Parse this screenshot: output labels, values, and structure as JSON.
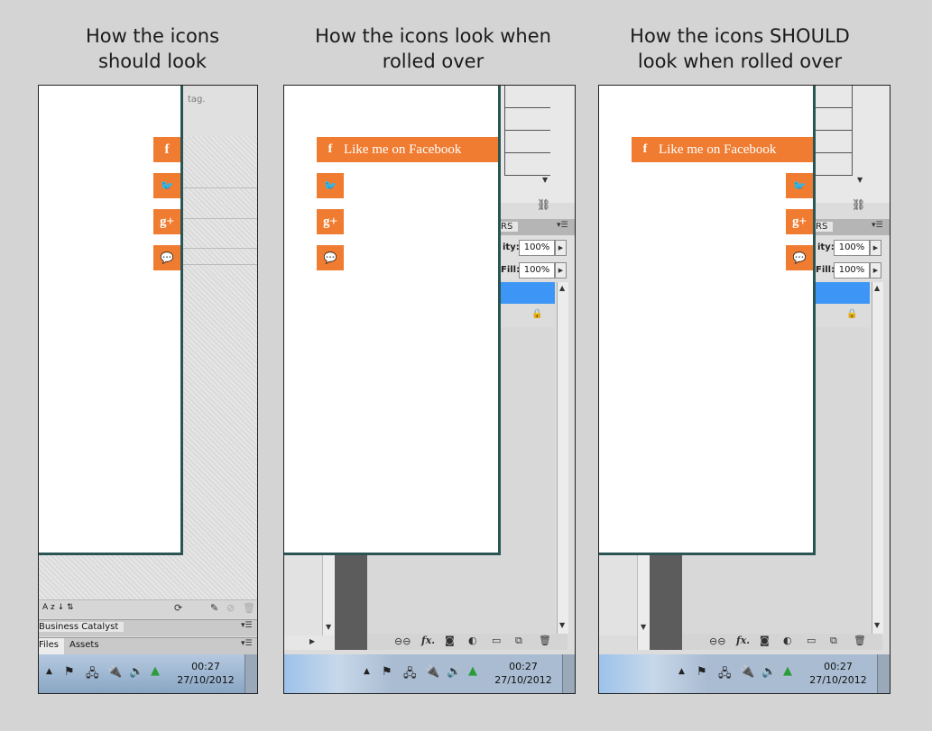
{
  "captions": {
    "left": [
      "How the icons",
      "should look"
    ],
    "middle": [
      "How the icons look when",
      "rolled over"
    ],
    "right": [
      "How the icons SHOULD",
      "look when rolled over"
    ]
  },
  "social": {
    "facebook_glyph": "f",
    "twitter_glyph": "🐦",
    "googleplus_glyph": "g+",
    "comment_glyph": "💬",
    "facebook_label": "Like me on Facebook"
  },
  "dreamweaver": {
    "tag_text": "tag.",
    "business_catalyst_tab": "Business Catalyst",
    "files_tab": "Files",
    "assets_tab": "Assets",
    "sort_icons": "A z ↓  ⇅"
  },
  "photoshop": {
    "panel_tab": "RS",
    "opacity_label": "ity:",
    "opacity_value": "100%",
    "fill_label": "Fill:",
    "fill_value": "100%",
    "bottom_icons": [
      "link-icon",
      "fx-icon",
      "mask-icon",
      "adjustment-icon",
      "group-icon",
      "new-layer-icon",
      "trash-icon"
    ],
    "fx_label": "fx."
  },
  "taskbar": {
    "time": "00:27",
    "date": "27/10/2012",
    "icons": [
      "show-hidden-icon",
      "action-center-flag-icon",
      "network-icon",
      "power-icon",
      "volume-icon",
      "google-drive-icon"
    ]
  },
  "colors": {
    "social_orange": "#f07c32",
    "page_border": "#2b5554",
    "selection_blue": "#3d96f5",
    "background": "#d4d4d4"
  }
}
